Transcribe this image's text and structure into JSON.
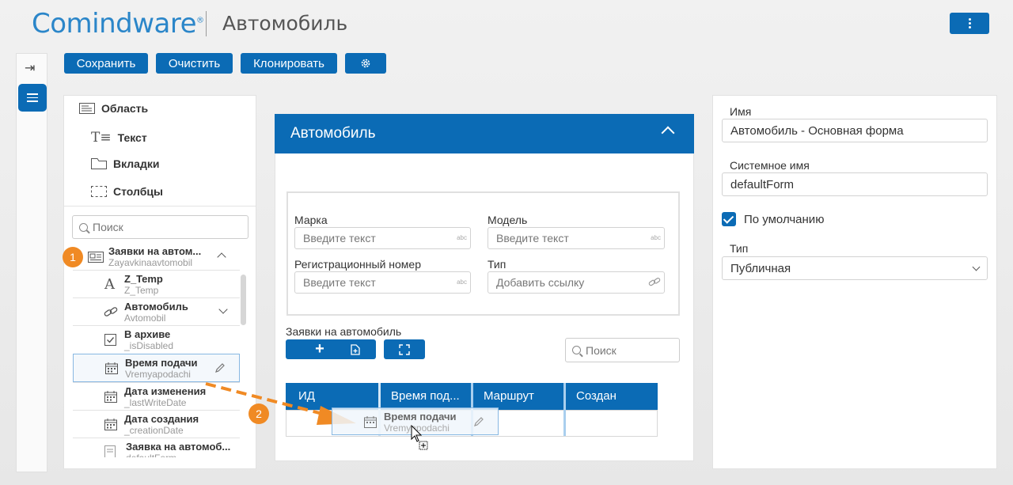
{
  "header": {
    "logo": "Comindware",
    "logo_mark": "®",
    "title": "Автомобиль"
  },
  "toolbar": {
    "save": "Сохранить",
    "clear": "Очистить",
    "clone": "Клонировать"
  },
  "palette": {
    "items": [
      {
        "label": "Область",
        "icon": "area-icon"
      },
      {
        "label": "Текст",
        "icon": "text-icon"
      },
      {
        "label": "Вкладки",
        "icon": "tabs-icon"
      },
      {
        "label": "Столбцы",
        "icon": "columns-icon"
      }
    ],
    "search_placeholder": "Поиск",
    "template": {
      "title": "Заявки на автом...",
      "system": "Zayavkinaavtomobil"
    },
    "fields": [
      {
        "name": "Z_Temp",
        "sys": "Z_Temp",
        "icon": "text-field-icon",
        "glyph": "A"
      },
      {
        "name": "Автомобиль",
        "sys": "Avtomobil",
        "icon": "link-icon",
        "glyph": "🔗"
      },
      {
        "name": "В архиве",
        "sys": "_isDisabled",
        "icon": "checkbox-icon",
        "glyph": "☑"
      },
      {
        "name": "Время подачи",
        "sys": "Vremyapodachi",
        "icon": "calendar-icon",
        "glyph": "▦"
      },
      {
        "name": "Дата изменения",
        "sys": "_lastWriteDate",
        "icon": "calendar-icon",
        "glyph": "▦"
      },
      {
        "name": "Дата создания",
        "sys": "_creationDate",
        "icon": "calendar-icon",
        "glyph": "▦"
      },
      {
        "name": "Заявка на автомоб...",
        "sys": "defaultForm",
        "icon": "form-icon",
        "glyph": "▤"
      }
    ]
  },
  "steps": {
    "one": "1",
    "two": "2"
  },
  "form": {
    "title": "Автомобиль",
    "fields": {
      "brand_label": "Марка",
      "brand_placeholder": "Введите текст",
      "model_label": "Модель",
      "model_placeholder": "Введите текст",
      "reg_label": "Регистрационный номер",
      "reg_placeholder": "Введите текст",
      "type_label": "Тип",
      "type_placeholder": "Добавить ссылку",
      "abc": "abc"
    },
    "table": {
      "title": "Заявки на автомобиль",
      "search_placeholder": "Поиск",
      "columns": [
        "ИД",
        "Время под...",
        "Маршрут",
        "Создан"
      ]
    },
    "drag": {
      "name": "Время подачи",
      "sys": "Vremyapodachi"
    }
  },
  "properties": {
    "name_label": "Имя",
    "name_value": "Автомобиль - Основная форма",
    "sysname_label": "Системное имя",
    "sysname_value": "defaultForm",
    "default_label": "По умолчанию",
    "type_label": "Тип",
    "type_value": "Публичная"
  }
}
